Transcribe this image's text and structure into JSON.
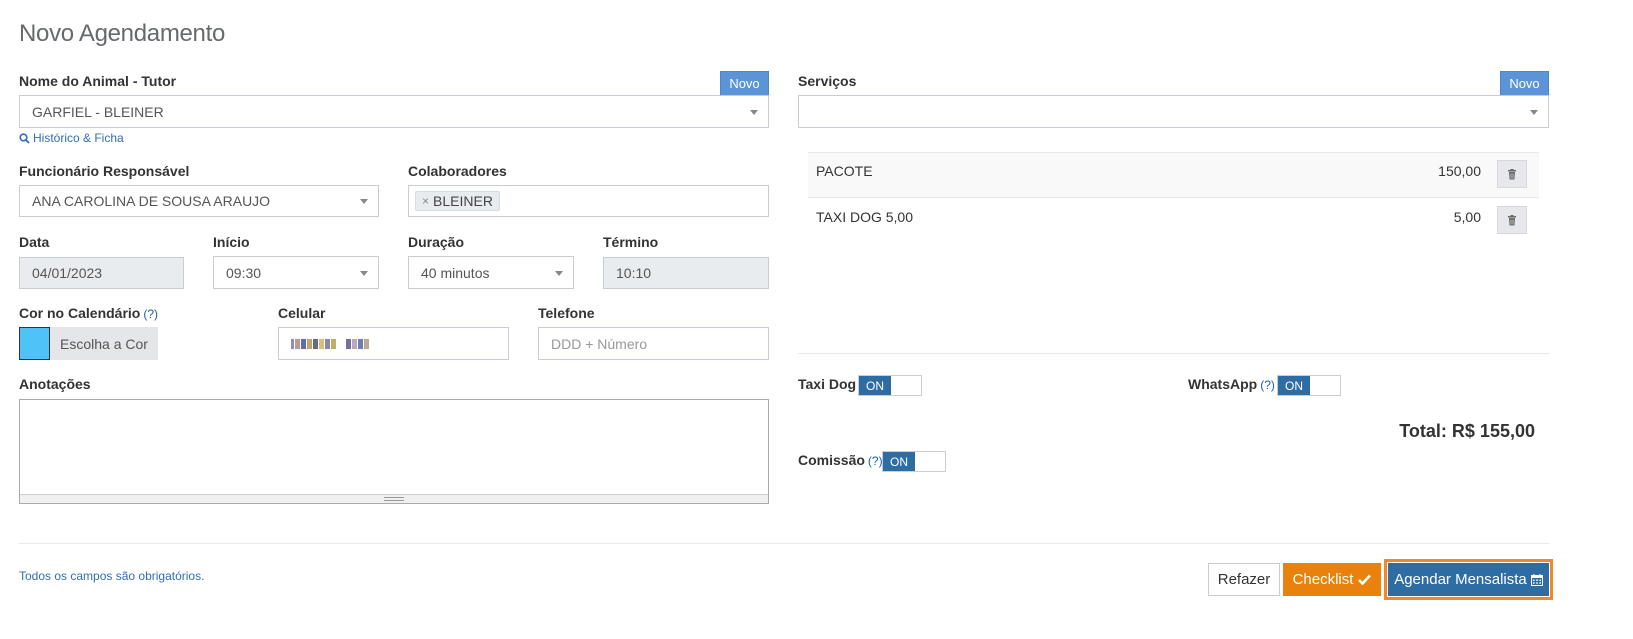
{
  "page": {
    "title": "Novo Agendamento",
    "required_note": "Todos os campos são obrigatórios."
  },
  "animal": {
    "label": "Nome do Animal - Tutor",
    "value": "GARFIEL - BLEINER",
    "novo_label": "Novo",
    "history_link": "Histórico & Ficha"
  },
  "funcionario": {
    "label": "Funcionário Responsável",
    "value": "ANA CAROLINA DE SOUSA ARAUJO"
  },
  "colaboradores": {
    "label": "Colaboradores",
    "tags": [
      "BLEINER"
    ]
  },
  "data": {
    "label": "Data",
    "value": "04/01/2023"
  },
  "inicio": {
    "label": "Início",
    "value": "09:30"
  },
  "duracao": {
    "label": "Duração",
    "value": "40 minutos"
  },
  "termino": {
    "label": "Término",
    "value": "10:10"
  },
  "cor": {
    "label": "Cor no Calendário",
    "help": "(?)",
    "button": "Escolha a Cor",
    "color": "#4fc3f7"
  },
  "celular": {
    "label": "Celular"
  },
  "telefone": {
    "label": "Telefone",
    "placeholder": "DDD + Número"
  },
  "anotacoes": {
    "label": "Anotações"
  },
  "servicos": {
    "label": "Serviços",
    "novo_label": "Novo",
    "items": [
      {
        "name": "PACOTE",
        "price": "150,00"
      },
      {
        "name": "TAXI DOG 5,00",
        "price": "5,00"
      }
    ]
  },
  "toggles": {
    "taxi_dog": {
      "label": "Taxi Dog",
      "state": "ON"
    },
    "whatsapp": {
      "label": "WhatsApp",
      "help": "(?)",
      "state": "ON"
    },
    "comissao": {
      "label": "Comissão",
      "help": "(?)",
      "state": "ON"
    }
  },
  "total": "Total: R$ 155,00",
  "actions": {
    "refazer": "Refazer",
    "checklist": "Checklist",
    "agendar": "Agendar Mensalista"
  },
  "colors": {
    "accent_blue": "#2e6da4",
    "orange": "#e8820c",
    "novo_blue": "#5b95d8"
  }
}
